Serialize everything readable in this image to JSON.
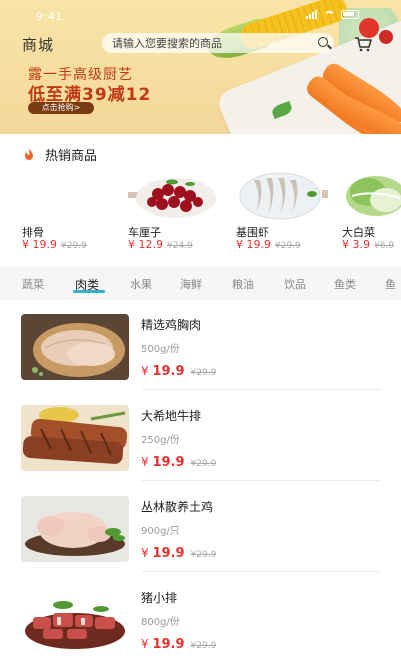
{
  "status_bar": {
    "time": "9:41"
  },
  "header": {
    "brand": "商城",
    "search_placeholder": "请输入您要搜索的商品"
  },
  "banner": {
    "line1": "露一手高级厨艺",
    "line2": "低至满39减12",
    "button": "点击抢购>"
  },
  "hot": {
    "title": "热销商品",
    "items": [
      {
        "name": "排骨",
        "price": "¥ 19.9",
        "old": "¥29.9"
      },
      {
        "name": "车厘子",
        "price": "¥ 12.9",
        "old": "¥24.9"
      },
      {
        "name": "基围虾",
        "price": "¥ 19.9",
        "old": "¥29.9"
      },
      {
        "name": "大白菜",
        "price": "¥ 3.9",
        "old": "¥6.9"
      }
    ]
  },
  "tabs": [
    "蔬菜",
    "肉类",
    "水果",
    "海鲜",
    "粮油",
    "饮品",
    "鱼类",
    "鱼"
  ],
  "active_tab": "肉类",
  "products": [
    {
      "name": "精选鸡胸肉",
      "spec": "500g/份",
      "price": "19.9",
      "old": "¥29.9"
    },
    {
      "name": "大希地牛排",
      "spec": "250g/份",
      "price": "19.9",
      "old": "¥29.9"
    },
    {
      "name": "丛林散养土鸡",
      "spec": "900g/只",
      "price": "19.9",
      "old": "¥29.9"
    },
    {
      "name": "猪小排",
      "spec": "800g/份",
      "price": "19.9",
      "old": "¥29.9"
    }
  ],
  "currency_symbol": "¥",
  "colors": {
    "price": "#e5322f",
    "accent": "#34b0c9",
    "banner": "#f7dea0",
    "promo": "#c03a14"
  }
}
